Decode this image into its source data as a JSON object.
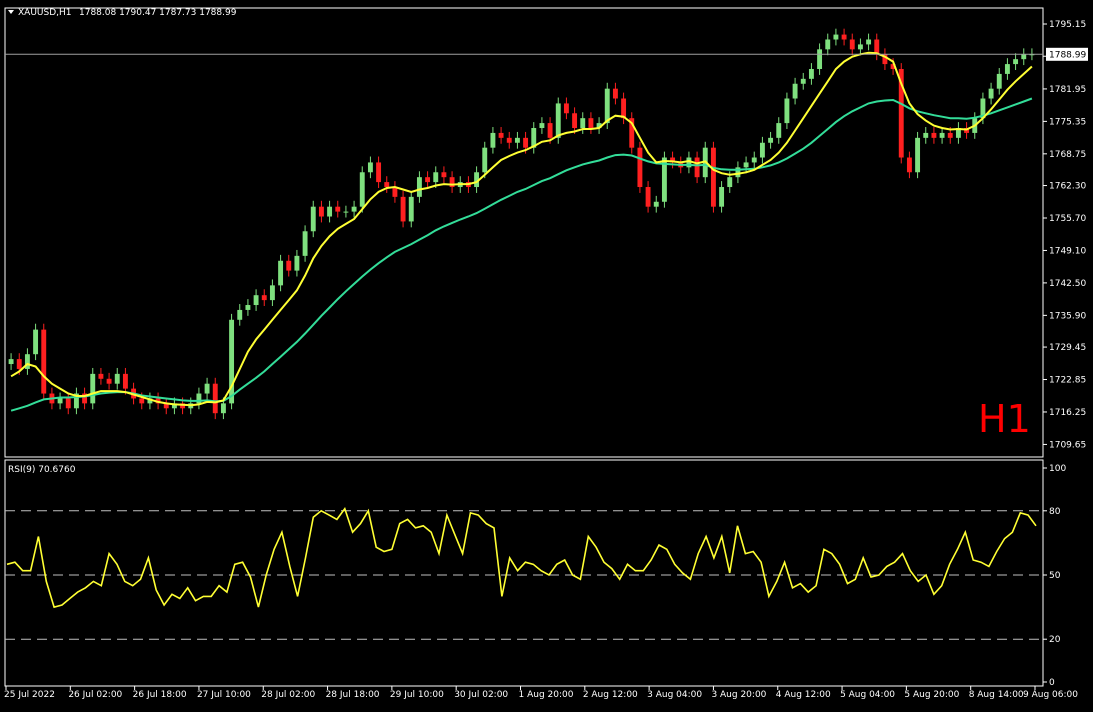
{
  "header": {
    "symbol_label": "XAUUSD,H1",
    "ohlc_label": "1788.08 1790.47 1787.73 1788.99"
  },
  "watermark": "H1",
  "rsi_panel": {
    "label": "RSI(9) 70.6760"
  },
  "colors": {
    "background": "#000000",
    "axis": "#ffffff",
    "bull_candle": "#7fe07f",
    "bear_candle": "#ff2020",
    "ma_fast": "#ffff33",
    "ma_slow": "#33dd99",
    "rsi_line": "#ffff33",
    "watermark": "#ff0000",
    "level_line": "#c0c0c0",
    "price_tag_bg": "#ffffff",
    "price_tag_text": "#000000"
  },
  "chart_data": [
    {
      "type": "candlestick",
      "title": "XAUUSD,H1",
      "timeframe": "H1",
      "current_price": "1788.99",
      "ylim": [
        1707.5,
        1798.0
      ],
      "y_ticks": [
        "1795.15",
        "1788.60",
        "1781.95",
        "1775.35",
        "1768.75",
        "1762.30",
        "1755.70",
        "1749.10",
        "1742.50",
        "1735.90",
        "1729.45",
        "1722.85",
        "1716.25",
        "1709.65"
      ],
      "x_ticks": [
        "25 Jul 2022",
        "26 Jul 02:00",
        "26 Jul 18:00",
        "27 Jul 10:00",
        "28 Jul 02:00",
        "28 Jul 18:00",
        "29 Jul 10:00",
        "30 Jul 02:00",
        "1 Aug 20:00",
        "2 Aug 12:00",
        "3 Aug 04:00",
        "3 Aug 20:00",
        "4 Aug 12:00",
        "5 Aug 04:00",
        "5 Aug 20:00",
        "8 Aug 14:00",
        "9 Aug 06:00"
      ],
      "close_series": [
        1727,
        1725,
        1728,
        1733,
        1720,
        1718,
        1719,
        1717,
        1720,
        1718,
        1724,
        1723,
        1722,
        1724,
        1721,
        1719,
        1718,
        1719,
        1718,
        1717,
        1718,
        1717,
        1718,
        1720,
        1722,
        1716,
        1718,
        1735,
        1737,
        1738,
        1740,
        1739,
        1742,
        1747,
        1745,
        1748,
        1753,
        1758,
        1756,
        1758,
        1757,
        1757,
        1758,
        1765,
        1767,
        1763,
        1762,
        1760,
        1755,
        1760,
        1764,
        1763,
        1765,
        1764,
        1762,
        1763,
        1762,
        1765,
        1770,
        1773,
        1772,
        1771,
        1772,
        1770,
        1774,
        1775,
        1772,
        1779,
        1777,
        1774,
        1776,
        1774,
        1775,
        1782,
        1780,
        1776,
        1770,
        1762,
        1758,
        1759,
        1768,
        1767,
        1766,
        1768,
        1764,
        1770,
        1758,
        1762,
        1764,
        1766,
        1767,
        1768,
        1771,
        1772,
        1775,
        1780,
        1783,
        1784,
        1786,
        1790,
        1792,
        1793,
        1792,
        1790,
        1791,
        1792,
        1789,
        1787,
        1786,
        1768,
        1765,
        1772,
        1773,
        1772,
        1773,
        1772,
        1774,
        1773,
        1776,
        1780,
        1782,
        1785,
        1787,
        1788,
        1789,
        1789
      ],
      "ma_fast": {
        "color": "#ffff33",
        "values": [
          1723.5,
          1724.5,
          1726.0,
          1725.5,
          1723.5,
          1722.0,
          1721.0,
          1720.0,
          1719.5,
          1719.5,
          1720.0,
          1720.5,
          1720.5,
          1720.5,
          1720.3,
          1719.8,
          1719.3,
          1718.8,
          1718.3,
          1718.0,
          1717.8,
          1717.7,
          1717.6,
          1717.8,
          1718.3,
          1718.2,
          1718.6,
          1721.5,
          1725.0,
          1728.5,
          1731.0,
          1733.0,
          1735.0,
          1737.0,
          1739.0,
          1741.0,
          1744.0,
          1747.5,
          1750.0,
          1752.0,
          1753.5,
          1754.5,
          1755.5,
          1757.5,
          1759.5,
          1761.0,
          1761.8,
          1762.0,
          1761.5,
          1761.0,
          1761.5,
          1761.8,
          1762.3,
          1762.6,
          1762.5,
          1762.6,
          1762.6,
          1763.0,
          1764.5,
          1766.0,
          1767.5,
          1768.3,
          1769.0,
          1769.5,
          1770.3,
          1771.2,
          1771.5,
          1772.5,
          1773.0,
          1773.3,
          1773.8,
          1773.8,
          1774.0,
          1775.5,
          1776.5,
          1776.3,
          1775.0,
          1772.0,
          1769.0,
          1767.0,
          1767.3,
          1767.2,
          1767.0,
          1767.3,
          1766.8,
          1767.2,
          1765.5,
          1764.8,
          1764.5,
          1764.7,
          1765.0,
          1765.5,
          1766.5,
          1767.5,
          1769.0,
          1771.0,
          1773.5,
          1776.0,
          1778.5,
          1781.0,
          1783.5,
          1786.0,
          1787.5,
          1788.5,
          1789.0,
          1789.3,
          1789.2,
          1788.5,
          1787.5,
          1783.0,
          1779.0,
          1776.8,
          1775.5,
          1774.5,
          1774.0,
          1773.7,
          1773.8,
          1773.7,
          1774.5,
          1776.0,
          1777.8,
          1779.8,
          1781.8,
          1783.5,
          1785.0,
          1786.5
        ]
      },
      "ma_slow": {
        "color": "#33dd99",
        "values": [
          1716.5,
          1717.0,
          1717.5,
          1718.2,
          1718.8,
          1719.0,
          1719.2,
          1719.2,
          1719.3,
          1719.4,
          1719.7,
          1720.0,
          1720.2,
          1720.3,
          1720.3,
          1720.0,
          1719.6,
          1719.4,
          1719.2,
          1719.0,
          1718.8,
          1718.6,
          1718.5,
          1718.5,
          1718.6,
          1718.4,
          1718.5,
          1719.5,
          1720.8,
          1722.0,
          1723.2,
          1724.5,
          1726.0,
          1727.5,
          1729.0,
          1730.5,
          1732.2,
          1734.0,
          1735.8,
          1737.5,
          1739.2,
          1740.8,
          1742.3,
          1743.8,
          1745.2,
          1746.5,
          1747.7,
          1748.8,
          1749.6,
          1750.4,
          1751.3,
          1752.2,
          1753.2,
          1754.0,
          1754.7,
          1755.4,
          1756.0,
          1756.7,
          1757.6,
          1758.5,
          1759.4,
          1760.2,
          1761.0,
          1761.6,
          1762.4,
          1763.2,
          1763.8,
          1764.6,
          1765.4,
          1766.0,
          1766.6,
          1767.0,
          1767.4,
          1768.0,
          1768.5,
          1768.6,
          1768.4,
          1767.8,
          1767.2,
          1766.8,
          1766.7,
          1766.6,
          1766.5,
          1766.5,
          1766.4,
          1766.5,
          1765.9,
          1765.6,
          1765.5,
          1765.5,
          1765.6,
          1765.7,
          1766.0,
          1766.4,
          1767.0,
          1767.8,
          1768.8,
          1769.8,
          1771.0,
          1772.4,
          1773.8,
          1775.2,
          1776.4,
          1777.4,
          1778.2,
          1779.0,
          1779.4,
          1779.6,
          1779.7,
          1778.9,
          1778.0,
          1777.4,
          1777.0,
          1776.6,
          1776.3,
          1776.0,
          1776.0,
          1775.9,
          1776.1,
          1776.5,
          1777.0,
          1777.6,
          1778.2,
          1778.8,
          1779.4,
          1780.0
        ]
      }
    },
    {
      "type": "line",
      "title": "RSI(9) 70.6760",
      "ylim": [
        0,
        100
      ],
      "y_ticks": [
        "100",
        "80",
        "50",
        "20",
        "0"
      ],
      "levels": [
        80,
        50,
        20
      ],
      "values": [
        55,
        56,
        52,
        52,
        68,
        47,
        35,
        36,
        39,
        42,
        44,
        47,
        45,
        60,
        55,
        47,
        45,
        48,
        58,
        43,
        36,
        41,
        39,
        44,
        38,
        40,
        40,
        45,
        42,
        55,
        56,
        49,
        35,
        50,
        62,
        70,
        54,
        40,
        58,
        77,
        80,
        78,
        76,
        81,
        70,
        74,
        80,
        63,
        61,
        62,
        74,
        76,
        72,
        73,
        70,
        60,
        78,
        69,
        60,
        79,
        78,
        74,
        72,
        40,
        58,
        52,
        56,
        55,
        52,
        50,
        55,
        57,
        50,
        48,
        68,
        63,
        56,
        53,
        48,
        55,
        52,
        52,
        57,
        64,
        62,
        55,
        51,
        48,
        60,
        68,
        58,
        68,
        51,
        73,
        60,
        61,
        56,
        40,
        47,
        56,
        44,
        46,
        42,
        45,
        62,
        60,
        55,
        46,
        48,
        58,
        49,
        50,
        54,
        56,
        60,
        52,
        47,
        50,
        41,
        45,
        55,
        62,
        70,
        57,
        56,
        54,
        61,
        67,
        70,
        79,
        78,
        73
      ]
    }
  ]
}
